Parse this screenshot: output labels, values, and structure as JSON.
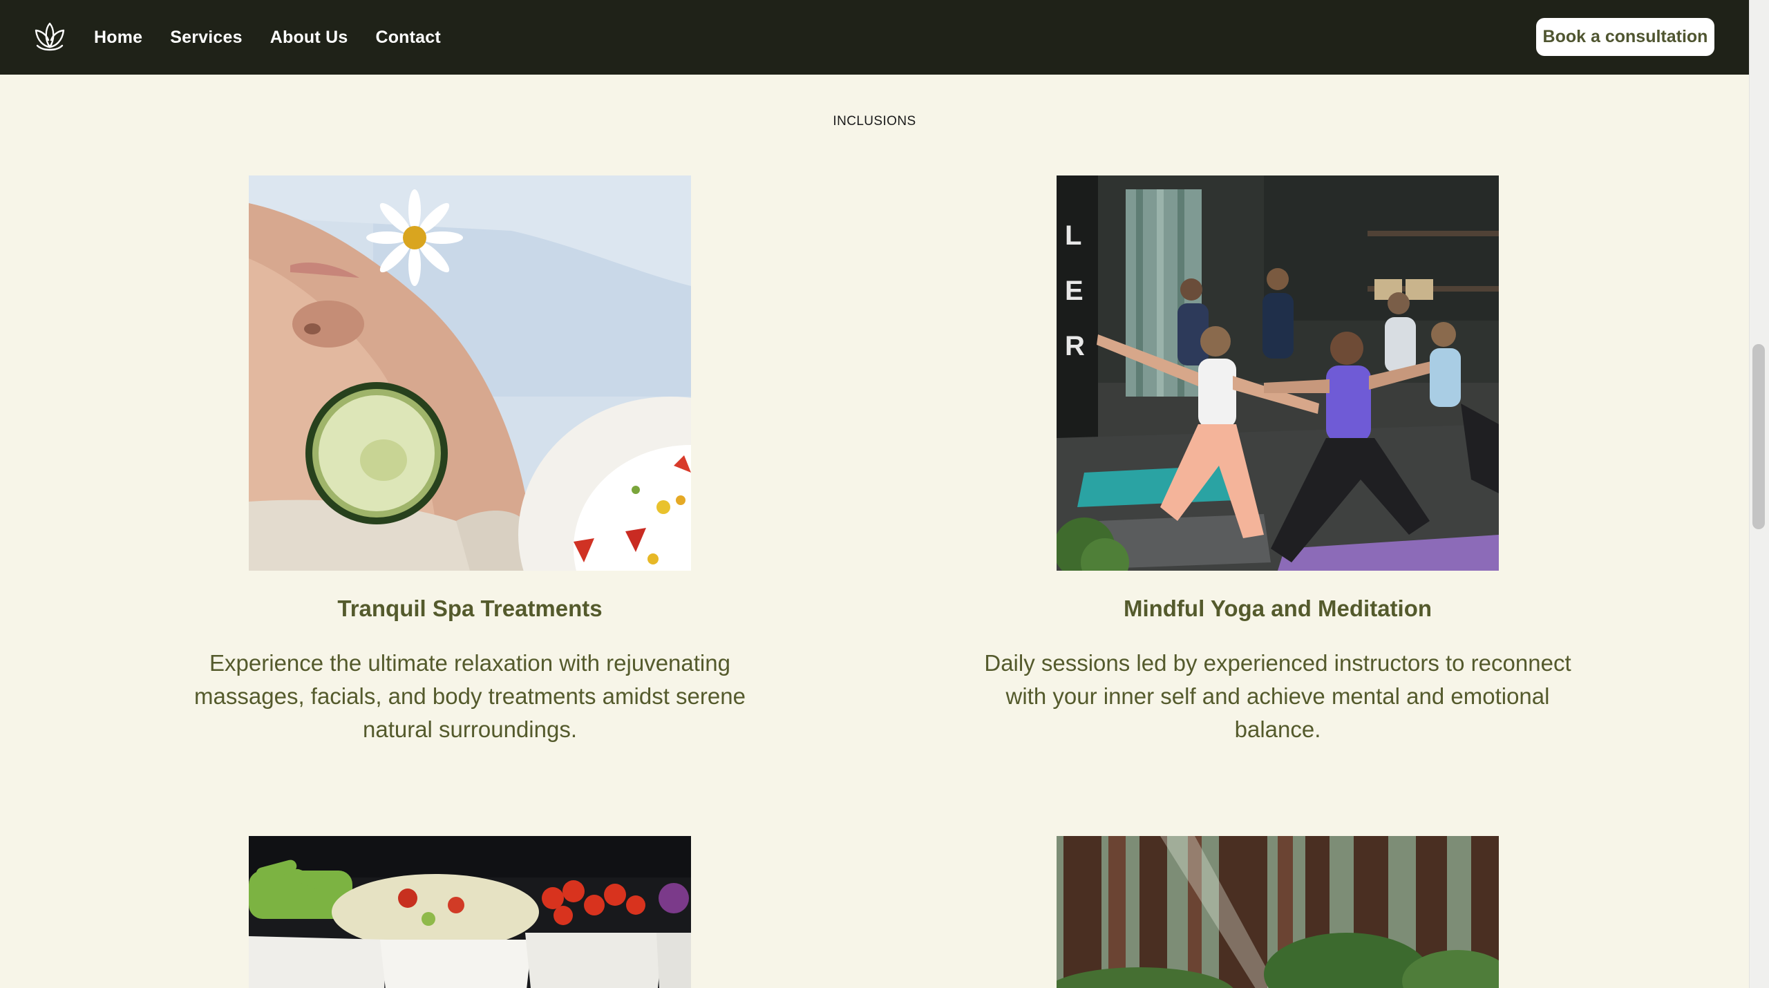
{
  "nav": {
    "logo_icon": "lotus-icon",
    "links": [
      "Home",
      "Services",
      "About Us",
      "Contact"
    ],
    "cta_label": "Book a consultation"
  },
  "section": {
    "label": "INCLUSIONS"
  },
  "cards": [
    {
      "image_icon": "spa-face-photo",
      "title": "Tranquil Spa Treatments",
      "description": "Experience the ultimate relaxation with rejuvenating massages, facials, and body treatments amidst serene natural surroundings."
    },
    {
      "image_icon": "yoga-class-photo",
      "title": "Mindful Yoga and Meditation",
      "description": "Daily sessions led by experienced instructors to reconnect with your inner self and achieve mental and emotional balance."
    },
    {
      "image_icon": "salad-bowls-photo"
    },
    {
      "image_icon": "redwood-forest-photo"
    }
  ],
  "colors": {
    "nav_bg": "#1f2218",
    "page_bg": "#f7f5e8",
    "accent_text": "#545a2c",
    "cta_bg": "#ffffff"
  }
}
